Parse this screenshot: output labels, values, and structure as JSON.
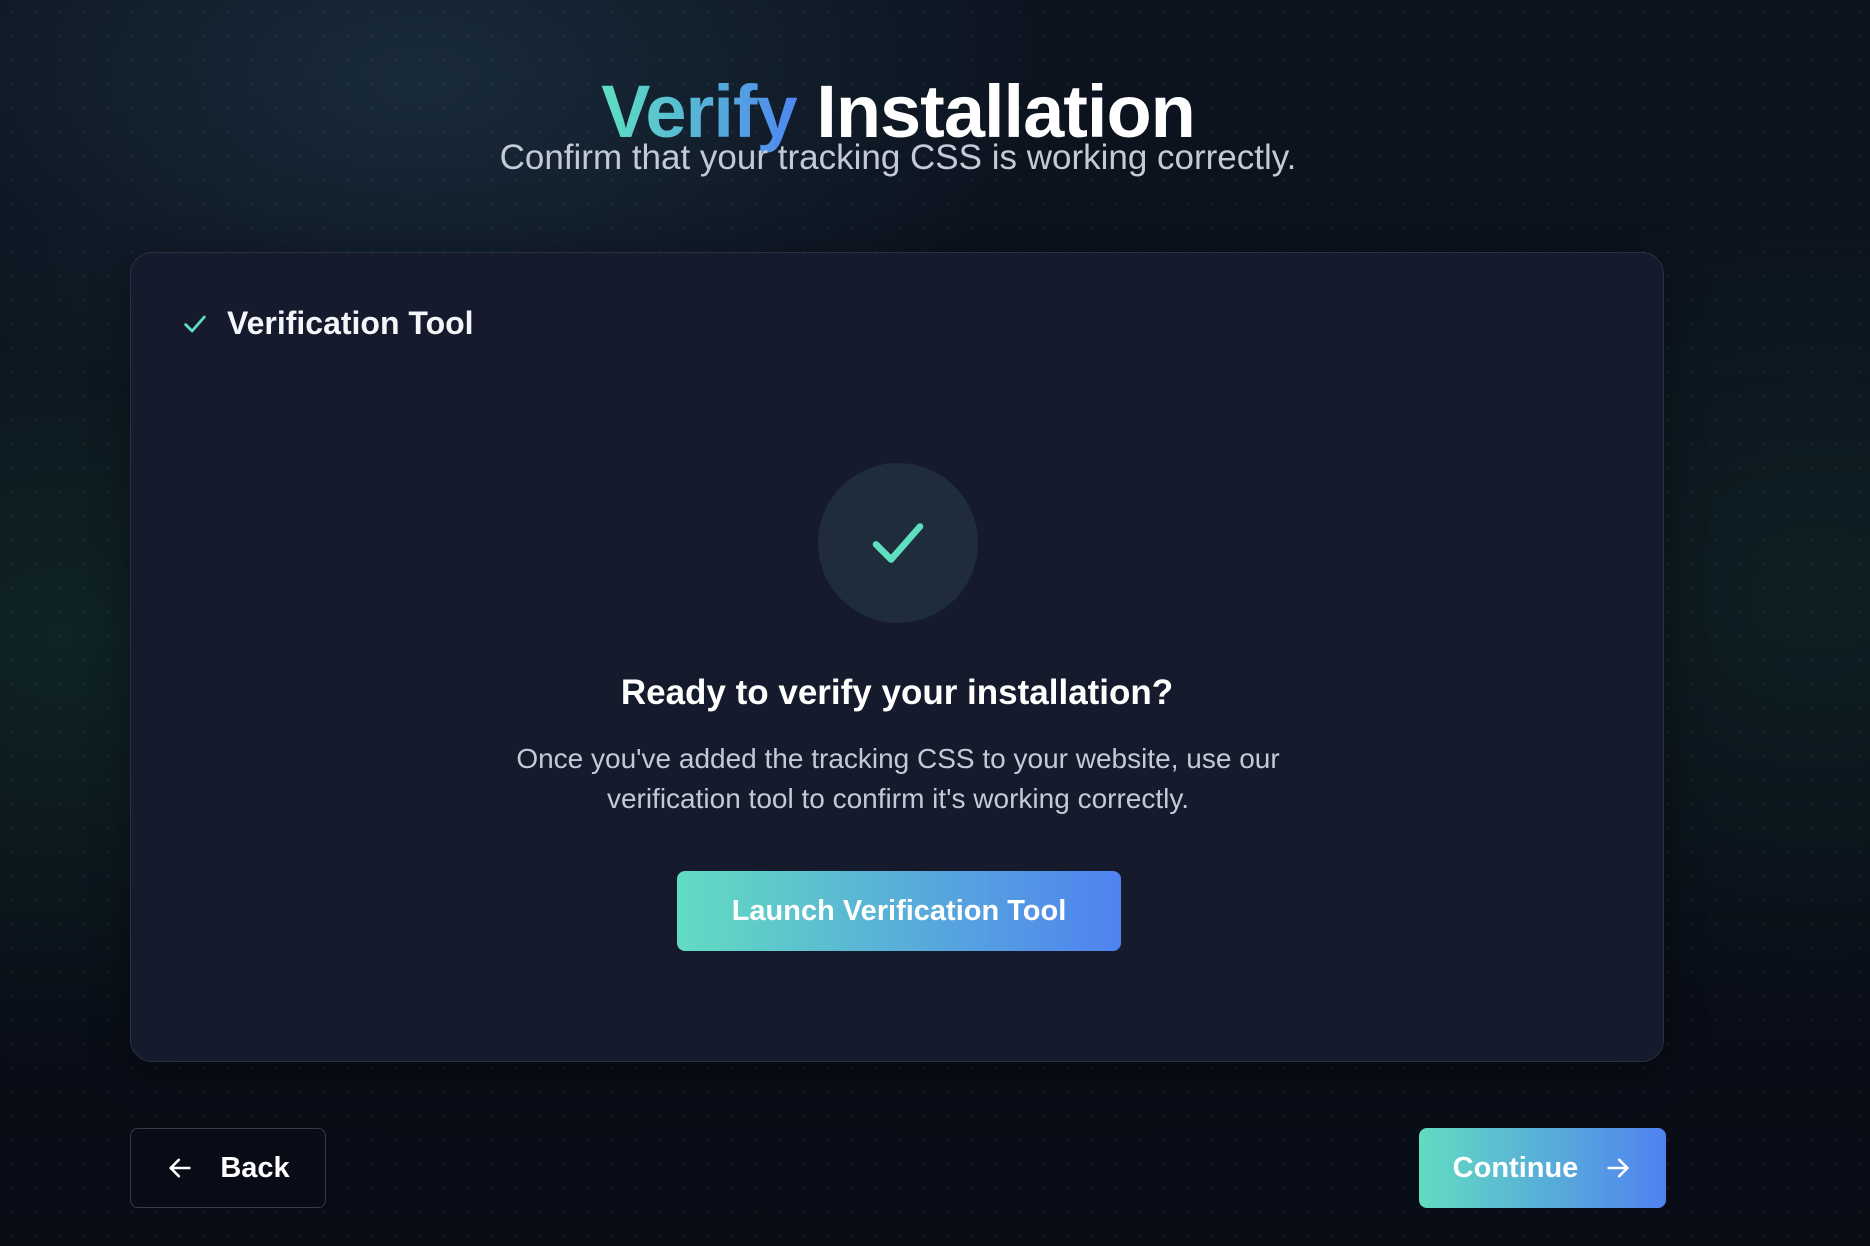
{
  "header": {
    "title_accent": "Verify",
    "title_rest": "Installation",
    "subtitle": "Confirm that your tracking CSS is working correctly."
  },
  "card": {
    "header_label": "Verification Tool",
    "heading": "Ready to verify your installation?",
    "description": "Once you've added the tracking CSS to your website, use our verification tool to confirm it's working correctly.",
    "launch_button_label": "Launch Verification Tool",
    "icons": {
      "header_icon": "check-icon",
      "status_icon": "check-icon"
    }
  },
  "footer": {
    "back_label": "Back",
    "back_icon": "arrow-left-icon",
    "continue_label": "Continue",
    "continue_icon": "arrow-right-icon"
  },
  "colors": {
    "accent_teal": "#5ee0c0",
    "accent_blue": "#4f86f0",
    "background": "#0a0f1a",
    "card_background": "#151b2d"
  }
}
